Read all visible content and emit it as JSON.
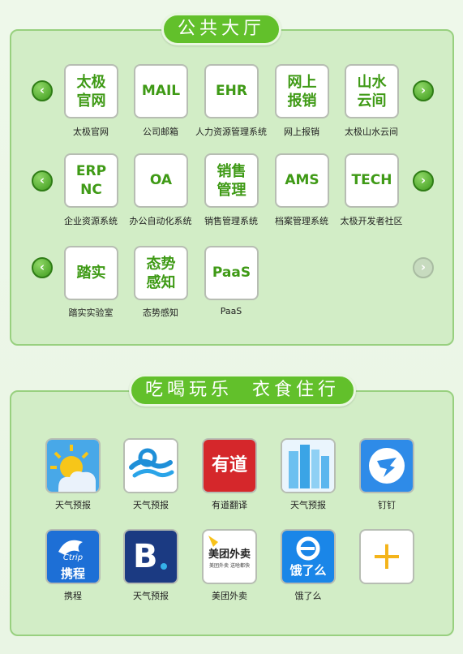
{
  "section1": {
    "title": "公共大厅",
    "rows": [
      [
        {
          "tile": "太极\n官网",
          "label": "太极官网"
        },
        {
          "tile": "MAIL",
          "label": "公司邮箱"
        },
        {
          "tile": "EHR",
          "label": "人力资源管理系统"
        },
        {
          "tile": "网上\n报销",
          "label": "网上报销"
        },
        {
          "tile": "山水\n云间",
          "label": "太极山水云间"
        }
      ],
      [
        {
          "tile": "ERP\nNC",
          "label": "企业资源系统"
        },
        {
          "tile": "OA",
          "label": "办公自动化系统"
        },
        {
          "tile": "销售\n管理",
          "label": "销售管理系统"
        },
        {
          "tile": "AMS",
          "label": "档案管理系统"
        },
        {
          "tile": "TECH",
          "label": "太极开发者社区"
        }
      ],
      [
        {
          "tile": "踏实",
          "label": "踏实实验室"
        },
        {
          "tile": "态势\n感知",
          "label": "态势感知"
        },
        {
          "tile": "PaaS",
          "label": "PaaS"
        }
      ]
    ],
    "arrows": {
      "left": "‹",
      "right": "›"
    }
  },
  "section2": {
    "title": "吃喝玩乐  衣食住行",
    "apps": [
      [
        {
          "icon": "weather-sun-icon",
          "label": "天气预报"
        },
        {
          "icon": "cloud-wave-icon",
          "label": "天气预报"
        },
        {
          "icon": "youdao-icon",
          "icon_text": "有道",
          "label": "有道翻译"
        },
        {
          "icon": "buildings-icon",
          "label": "天气预报"
        },
        {
          "icon": "dingtalk-icon",
          "label": "钉钉"
        }
      ],
      [
        {
          "icon": "ctrip-icon",
          "icon_text": "携程",
          "icon_subtext": "Ctrip",
          "label": "携程"
        },
        {
          "icon": "booking-icon",
          "icon_text": "B",
          "label": "天气预报"
        },
        {
          "icon": "meituan-icon",
          "icon_text": "美团外卖",
          "icon_subtext": "美团外卖 送啥都快",
          "label": "美团外卖"
        },
        {
          "icon": "eleme-icon",
          "icon_text": "饿了么",
          "label": "饿了么"
        },
        {
          "icon": "plus-icon",
          "icon_text": "+",
          "label": ""
        }
      ]
    ]
  },
  "colors": {
    "accent": "#62c02b",
    "panel": "#d2edc6",
    "tile_text": "#3f9a16"
  }
}
